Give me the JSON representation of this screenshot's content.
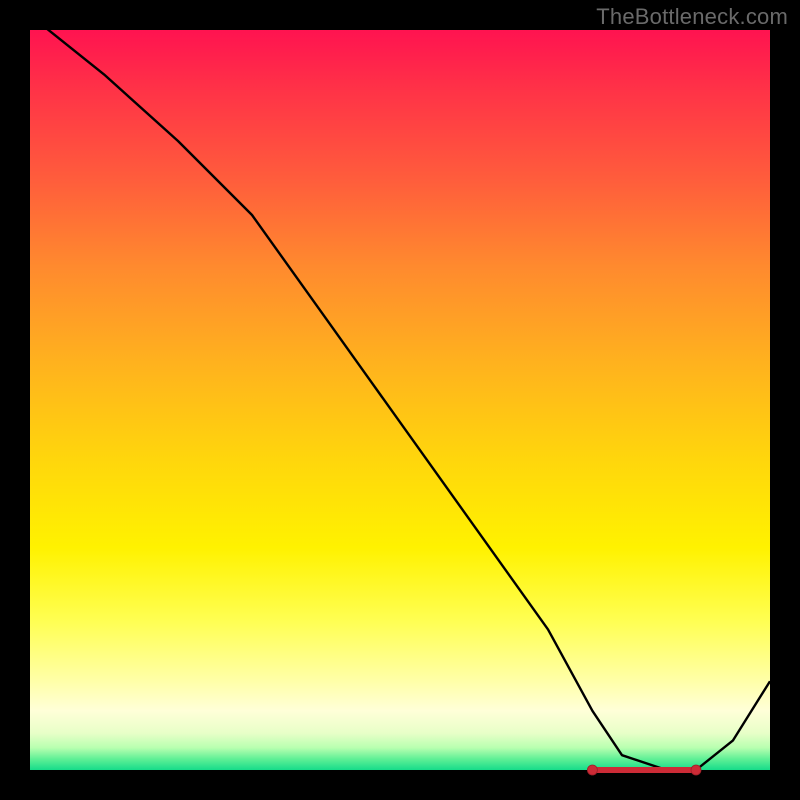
{
  "watermark": "TheBottleneck.com",
  "chart_data": {
    "type": "line",
    "title": "",
    "xlabel": "",
    "ylabel": "",
    "grid": false,
    "legend": false,
    "xlim": [
      0,
      100
    ],
    "ylim": [
      0,
      100
    ],
    "x": [
      0,
      10,
      20,
      30,
      40,
      50,
      60,
      70,
      76,
      80,
      86,
      90,
      95,
      100
    ],
    "values": [
      102,
      94,
      85,
      75,
      61,
      47,
      33,
      19,
      8,
      2,
      0,
      0,
      4,
      12
    ],
    "minimum_region_x": [
      76,
      90
    ],
    "colors": {
      "gradient_top": "#ff1350",
      "gradient_mid": "#fff200",
      "gradient_bottom": "#16dc8a",
      "curve": "#000000",
      "marker": "#cc2b36"
    }
  }
}
